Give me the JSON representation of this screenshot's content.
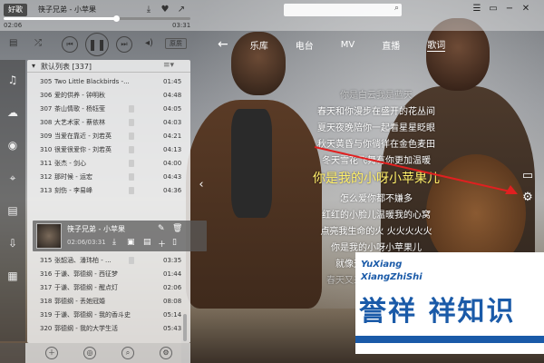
{
  "topbar": {
    "mode_label": "好歌",
    "song_title": "筷子兄弟 - 小苹果",
    "time_current": "02:06",
    "time_total": "03:31",
    "progress_fraction": 0.6,
    "search_placeholder": ""
  },
  "controls": {
    "quality_label": "原质"
  },
  "nav": {
    "back_glyph": "←",
    "tabs": [
      {
        "label": "乐库",
        "active": false
      },
      {
        "label": "电台",
        "active": false
      },
      {
        "label": "MV",
        "active": false
      },
      {
        "label": "直播",
        "active": false
      },
      {
        "label": "歌词",
        "active": true
      }
    ]
  },
  "playlist": {
    "name": "默认列表 [337]",
    "rows": [
      {
        "no": "305",
        "title": "Two Little Blackbirds -...",
        "duration": "01:45"
      },
      {
        "no": "306",
        "title": "爱的供养 - 钟明秋",
        "duration": "04:48"
      },
      {
        "no": "307",
        "title": "茶山情歌 - 杨钰莹",
        "duration": "04:05"
      },
      {
        "no": "308",
        "title": "大艺术家 - 蔡依林",
        "duration": "04:03"
      },
      {
        "no": "309",
        "title": "当爱在靠近 - 刘若英",
        "duration": "04:21"
      },
      {
        "no": "310",
        "title": "很爱很爱你 - 刘若英",
        "duration": "04:13"
      },
      {
        "no": "311",
        "title": "张杰 - 剑心",
        "duration": "04:00"
      },
      {
        "no": "312",
        "title": "那时候 - 运宏",
        "duration": "04:43"
      },
      {
        "no": "313",
        "title": "刻伤 - 李易峰",
        "duration": "04:36"
      }
    ],
    "current": {
      "title": "筷子兄弟 - 小苹果",
      "time": "02:06/03:31"
    },
    "rows_after": [
      {
        "no": "315",
        "title": "张韶涵、潘玮柏 - ...",
        "duration": "03:35"
      },
      {
        "no": "316",
        "title": "于谦、郭德纲 - 西征梦",
        "duration": "01:44"
      },
      {
        "no": "317",
        "title": "于谦、郭德纲 - 醒点灯",
        "duration": "02:06"
      },
      {
        "no": "318",
        "title": "郭德纲 - 丢她冠婚",
        "duration": "08:08"
      },
      {
        "no": "319",
        "title": "于谦、郭德纲 - 我的香斗史",
        "duration": "05:14"
      },
      {
        "no": "320",
        "title": "郭德纲 - 我的大学生活",
        "duration": "05:43"
      }
    ]
  },
  "lyrics": {
    "lines": [
      {
        "text": "你是白云我是蓝天",
        "style": "dim"
      },
      {
        "text": "春天和你漫步在盛开的花丛间",
        "style": "normal"
      },
      {
        "text": "夏天夜晚陪你一起看星星眨眼",
        "style": "normal"
      },
      {
        "text": "秋天黄昏与你徜徉在金色麦田",
        "style": "normal"
      },
      {
        "text": "冬天雪花飞舞有你更加温暖",
        "style": "normal"
      },
      {
        "text": "你是我的小呀小苹果儿",
        "style": "current",
        "done_chars": "你是我的"
      },
      {
        "text": "怎么爱你都不嫌多",
        "style": "normal"
      },
      {
        "text": "红红的小脸儿温暖我的心窝",
        "style": "normal"
      },
      {
        "text": "点亮我生命的火 火火火火火",
        "style": "normal"
      },
      {
        "text": "你是我的小呀小苹果儿",
        "style": "normal"
      },
      {
        "text": "就像天边最美的云朵",
        "style": "normal"
      },
      {
        "text": "春天又来到了花开满山坡",
        "style": "dim"
      }
    ]
  },
  "watermark": {
    "en_line1": "YuXiang",
    "en_line2": "XiangZhiShi",
    "cn_text": "誉祥 祥知识"
  },
  "colors": {
    "accent": "#ffef6a",
    "watermark_blue": "#1a5aa8"
  }
}
